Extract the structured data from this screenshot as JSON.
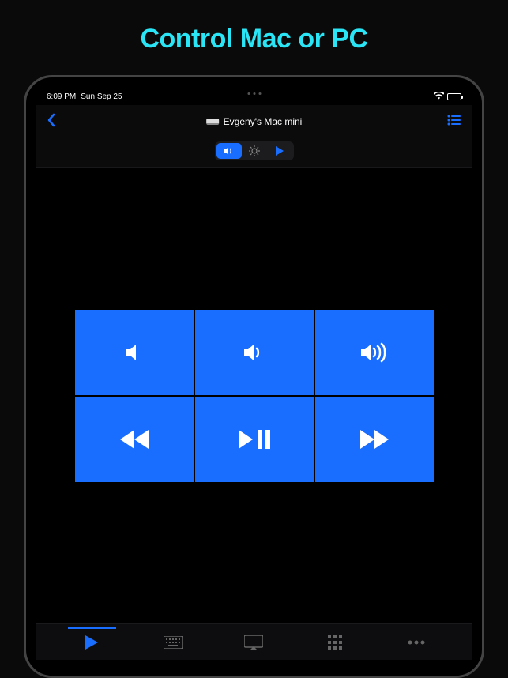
{
  "headline": "Control Mac or PC",
  "status": {
    "time": "6:09 PM",
    "date": "Sun Sep 25"
  },
  "nav": {
    "title": "Evgeny's Mac mini"
  },
  "segments": {
    "volume": "volume",
    "brightness": "brightness",
    "play": "play"
  },
  "controls": {
    "mute": "mute",
    "vol_down": "volume-down",
    "vol_up": "volume-up",
    "rewind": "rewind",
    "play_pause": "play-pause",
    "forward": "fast-forward"
  },
  "tabs": {
    "remote": "remote",
    "keyboard": "keyboard",
    "screen": "screen",
    "grid": "apps",
    "more": "more"
  },
  "colors": {
    "accent": "#1a6eff",
    "headline": "#2ae5f5"
  }
}
